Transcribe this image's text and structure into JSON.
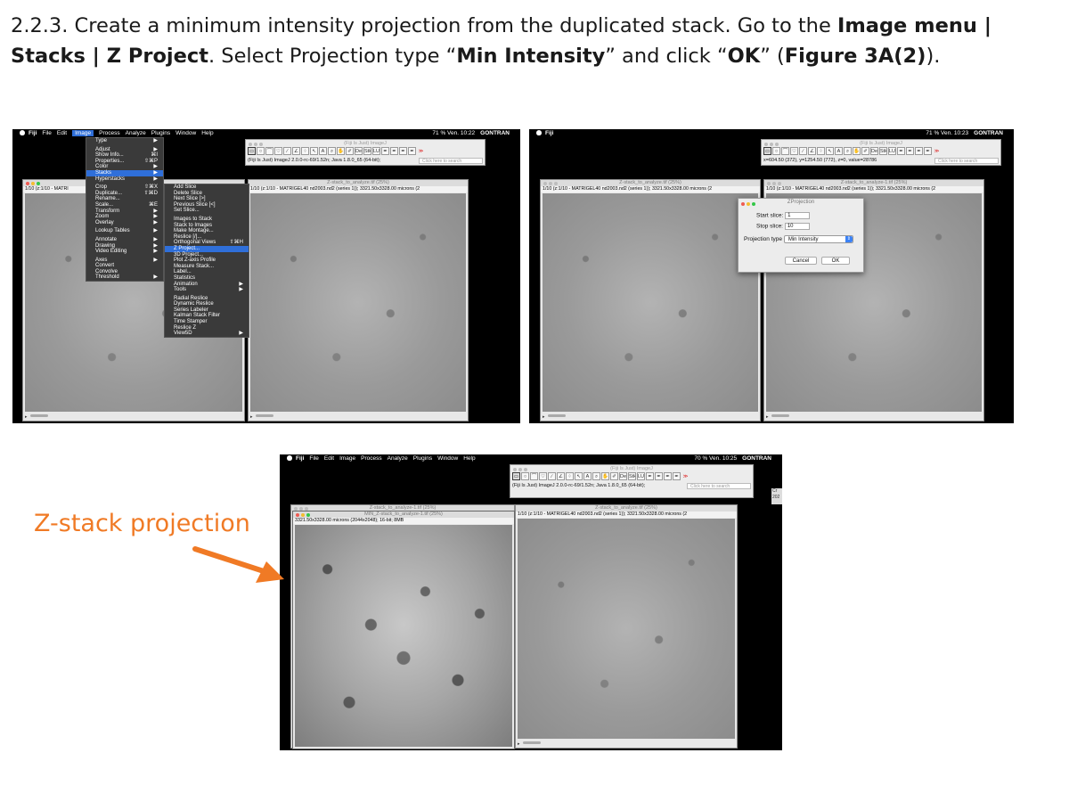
{
  "instruction": {
    "step": "2.2.3. Create a minimum intensity projection from the duplicated stack. Go to the ",
    "menu_path_1": "Image menu |",
    "menu_path_2": "Stacks | Z Project",
    "mid": ". Select Projection type “",
    "projection": "Min Intensity",
    "mid2": "” and click “",
    "ok": "OK",
    "mid3": "” (",
    "figure_ref": "Figure 3A(2)",
    "end": ")."
  },
  "callout": {
    "label": "Z-stack projection",
    "color": "#f07a25"
  },
  "macbar_common": {
    "app": "Fiji",
    "menus": [
      "File",
      "Edit",
      "Image",
      "Process",
      "Analyze",
      "Plugins",
      "Window",
      "Help"
    ],
    "user": "GONTRAN"
  },
  "shot1": {
    "status_right": "71 %  Ven. 10:22",
    "fiji_title": "(Fiji Is Just) ImageJ",
    "fiji_status": "(Fiji Is Just) ImageJ 2.0.0-rc-69/1.52n; Java 1.8.0_65 (64-bit);",
    "search_placeholder": "Click here to search",
    "win_left_info": "1/10 (z:1/10 - MATRI",
    "win_right_title": "Z-stack_to_analyze.tif (25%)",
    "win_right_info": "1/10 (z:1/10 - MATRIGEL40 nd2003.nd2 (series 1)); 3321.50x3328.00 microns (2",
    "image_menu": [
      {
        "label": "Type",
        "sc": "▶"
      },
      {
        "sep": true
      },
      {
        "label": "Adjust",
        "sc": "▶"
      },
      {
        "label": "Show Info...",
        "sc": "⌘I"
      },
      {
        "label": "Properties...",
        "sc": "⇧⌘P"
      },
      {
        "label": "Color",
        "sc": "▶"
      },
      {
        "label": "Stacks",
        "sc": "▶",
        "sel": true
      },
      {
        "label": "Hyperstacks",
        "sc": "▶"
      },
      {
        "sep": true
      },
      {
        "label": "Crop",
        "sc": "⇧⌘X"
      },
      {
        "label": "Duplicate...",
        "sc": "⇧⌘D"
      },
      {
        "label": "Rename..."
      },
      {
        "label": "Scale...",
        "sc": "⌘E"
      },
      {
        "label": "Transform",
        "sc": "▶"
      },
      {
        "label": "Zoom",
        "sc": "▶"
      },
      {
        "label": "Overlay",
        "sc": "▶"
      },
      {
        "sep": true
      },
      {
        "label": "Lookup Tables",
        "sc": "▶"
      },
      {
        "sep": true
      },
      {
        "label": "Annotate",
        "sc": "▶"
      },
      {
        "label": "Drawing",
        "sc": "▶"
      },
      {
        "label": "Video Editing",
        "sc": "▶"
      },
      {
        "sep": true
      },
      {
        "label": "Axes",
        "sc": "▶"
      },
      {
        "label": "Convert"
      },
      {
        "label": "Convolve"
      },
      {
        "label": "Threshold",
        "sc": "▶"
      }
    ],
    "stacks_menu": [
      {
        "label": "Add Slice"
      },
      {
        "label": "Delete Slice"
      },
      {
        "label": "Next Slice [>]"
      },
      {
        "label": "Previous Slice [<]"
      },
      {
        "label": "Set Slice..."
      },
      {
        "sep": true
      },
      {
        "label": "Images to Stack"
      },
      {
        "label": "Stack to Images"
      },
      {
        "label": "Make Montage..."
      },
      {
        "label": "Reslice [/]..."
      },
      {
        "label": "Orthogonal Views",
        "sc": "⇧⌘H"
      },
      {
        "label": "Z Project...",
        "sel": true
      },
      {
        "label": "3D Project..."
      },
      {
        "label": "Plot Z-axis Profile"
      },
      {
        "label": "Measure Stack..."
      },
      {
        "label": "Label..."
      },
      {
        "label": "Statistics"
      },
      {
        "label": "Animation",
        "sc": "▶"
      },
      {
        "label": "Tools",
        "sc": "▶"
      },
      {
        "sep": true
      },
      {
        "label": "Radial Reslice"
      },
      {
        "label": "Dynamic Reslice"
      },
      {
        "label": "Series Labeler"
      },
      {
        "label": "Kalman Stack Filter"
      },
      {
        "label": "Time Stamper"
      },
      {
        "label": "Reslice Z"
      },
      {
        "label": "View5D",
        "sc": "▶"
      }
    ]
  },
  "shot2": {
    "status_right": "71 %  Ven. 10:23",
    "fiji_title": "(Fiji Is Just) ImageJ",
    "fiji_status": "x=604.50 (372), y=1254.50 (772), z=0, value=28786",
    "search_placeholder": "Click here to search",
    "win_left_title": "Z-stack_to_analyze.tif (25%)",
    "win_left_info": "1/10 (z:1/10 - MATRIGEL40 nd2003.nd2 (series 1)); 3321.50x3328.00 microns (2",
    "win_right_title": "Z-stack_to_analyze-1.tif (25%)",
    "win_right_info": "1/10 (z:1/10 - MATRIGEL40 nd2003.nd2 (series 1)); 3321.50x3328.00 microns (2",
    "dialog": {
      "title": "ZProjection",
      "start_label": "Start slice:",
      "start_value": "1",
      "stop_label": "Stop slice:",
      "stop_value": "10",
      "type_label": "Projection type",
      "type_value": "Min Intensity",
      "cancel": "Cancel",
      "ok": "OK"
    }
  },
  "shot3": {
    "status_right": "70 %  Ven. 10:25",
    "fiji_title": "(Fiji Is Just) ImageJ",
    "fiji_status": "(Fiji Is Just) ImageJ 2.0.0-rc-69/1.52n; Java 1.8.0_65 (64-bit);",
    "search_placeholder": "Click here to search",
    "win_back_title": "Z-stack_to_analyze-1.tif (25%)",
    "win_min_title": "MIN_Z-stack_to_analyze-1.tif (25%)",
    "win_min_info": "3321.50x3328.00 microns (2044x2048); 16-bit; 8MB",
    "win_right_title": "Z-stack_to_analyze.tif (25%)",
    "win_right_info": "1/10 (z:1/10 - MATRIGEL40 nd2003.nd2 (series 1)); 3321.50x3328.00 microns (2",
    "side_snip_1": "Cr",
    "side_snip_2": "202"
  },
  "tools": [
    "▭",
    "○",
    "⌒",
    "♡",
    "∕",
    "∠",
    "⁘",
    "↖",
    "A",
    "⌕",
    "✋",
    "✐",
    "Dev",
    "Stk",
    "LUT",
    "✒",
    "✒",
    "✒",
    "✒",
    "≫"
  ]
}
